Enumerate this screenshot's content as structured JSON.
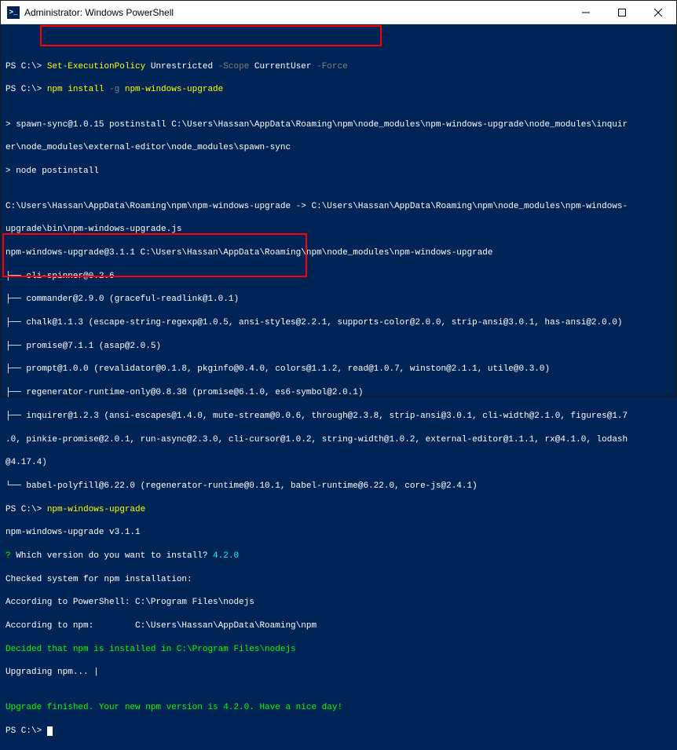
{
  "titlebar": {
    "icon_text": ">_",
    "title": "Administrator: Windows PowerShell"
  },
  "lines": {
    "l1_a": "PS C:\\> ",
    "l1_b": "Set-ExecutionPolicy ",
    "l1_c": "Unrestricted ",
    "l1_d": "-Scope ",
    "l1_e": "CurrentUser ",
    "l1_f": "-Force",
    "l2_a": "PS C:\\> ",
    "l2_b": "npm install ",
    "l2_c": "-g ",
    "l2_d": "npm-windows-upgrade",
    "l3": "",
    "l4": "> spawn-sync@1.0.15 postinstall C:\\Users\\Hassan\\AppData\\Roaming\\npm\\node_modules\\npm-windows-upgrade\\node_modules\\inquir",
    "l5": "er\\node_modules\\external-editor\\node_modules\\spawn-sync",
    "l6": "> node postinstall",
    "l7": "",
    "l8": "C:\\Users\\Hassan\\AppData\\Roaming\\npm\\npm-windows-upgrade -> C:\\Users\\Hassan\\AppData\\Roaming\\npm\\node_modules\\npm-windows-",
    "l9": "upgrade\\bin\\npm-windows-upgrade.js",
    "l10": "npm-windows-upgrade@3.1.1 C:\\Users\\Hassan\\AppData\\Roaming\\npm\\node_modules\\npm-windows-upgrade",
    "l11": "├── cli-spinner@0.2.6",
    "l12": "├── commander@2.9.0 (graceful-readlink@1.0.1)",
    "l13": "├── chalk@1.1.3 (escape-string-regexp@1.0.5, ansi-styles@2.2.1, supports-color@2.0.0, strip-ansi@3.0.1, has-ansi@2.0.0)",
    "l14": "├── promise@7.1.1 (asap@2.0.5)",
    "l15": "├── prompt@1.0.0 (revalidator@0.1.8, pkginfo@0.4.0, colors@1.1.2, read@1.0.7, winston@2.1.1, utile@0.3.0)",
    "l16": "├── regenerator-runtime-only@0.8.38 (promise@6.1.0, es6-symbol@2.0.1)",
    "l17": "├── inquirer@1.2.3 (ansi-escapes@1.4.0, mute-stream@0.0.6, through@2.3.8, strip-ansi@3.0.1, cli-width@2.1.0, figures@1.7",
    "l18": ".0, pinkie-promise@2.0.1, run-async@2.3.0, cli-cursor@1.0.2, string-width@1.0.2, external-editor@1.1.1, rx@4.1.0, lodash",
    "l19": "@4.17.4)",
    "l20": "└── babel-polyfill@6.22.0 (regenerator-runtime@0.10.1, babel-runtime@6.22.0, core-js@2.4.1)",
    "l21_a": "PS C:\\> ",
    "l21_b": "npm-windows-upgrade",
    "l22": "npm-windows-upgrade v3.1.1",
    "l23_a": "? ",
    "l23_b": "Which version do you want to install? ",
    "l23_c": "4.2.0",
    "l24": "Checked system for npm installation:",
    "l25": "According to PowerShell: C:\\Program Files\\nodejs",
    "l26": "According to npm:        C:\\Users\\Hassan\\AppData\\Roaming\\npm",
    "l27": "Decided that npm is installed in C:\\Program Files\\nodejs",
    "l28": "Upgrading npm... |",
    "l29": "",
    "l30": "Upgrade finished. Your new npm version is 4.2.0. Have a nice day!",
    "l31": "PS C:\\> "
  }
}
